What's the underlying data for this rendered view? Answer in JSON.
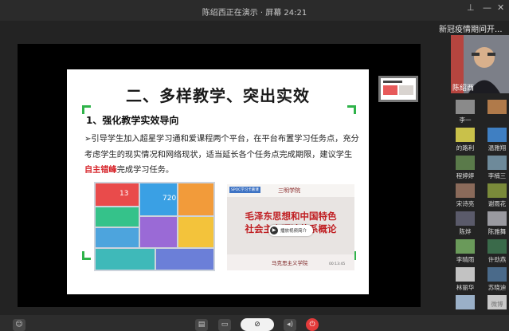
{
  "window": {
    "title": "陈绍西正在演示 · 屏幕 24:21",
    "pin_icon": "⊥",
    "minimize_icon": "—",
    "close_icon": "✕"
  },
  "slide": {
    "title": "二、多样教学、突出实效",
    "subhead": "1、强化教学实效导向",
    "para_before": "➢引导学生加入超星学习通和爱课程两个平台，在平台布置学习任务点，充分考虑学生的现实情况和网络现状，适当延长各个任务点完成期限，建议学生",
    "para_highlight": "自主错峰",
    "para_after": "完成学习任务。",
    "app_tiles": [
      {
        "label": "13",
        "color": "#e94b4b"
      },
      {
        "label": "720",
        "color": "#3aa0e4"
      },
      {
        "label": "",
        "color": "#f29b3a"
      },
      {
        "label": "",
        "color": "#35c28a"
      },
      {
        "label": "",
        "color": "#4da4dd"
      },
      {
        "label": "",
        "color": "#9a6ad6"
      },
      {
        "label": "",
        "color": "#f3c33b"
      },
      {
        "label": "",
        "color": "#3fb9b9"
      },
      {
        "label": "",
        "color": "#6b7fd8"
      }
    ],
    "video_badge": "SPOC学习卡慕课",
    "video_school": "三明学院",
    "video_title_1": "毛泽东思想和中国特色",
    "video_title_2": "社会主义理论体系概论",
    "video_play_label": "播放视频简介",
    "video_bottom": "马克思主义学院",
    "video_time": "00:13:45"
  },
  "controls": {
    "participants_icon": "people-icon",
    "chat_icon": "chat-icon",
    "folder_icon": "folder-icon",
    "camera_icon": "camera-off-icon",
    "volume_icon": "speaker-icon",
    "leave_icon": "power-icon"
  },
  "sidebar": {
    "meeting_title": "新冠疫情期间开...",
    "host_name": "陈绍西",
    "participants": [
      {
        "name": "李一",
        "color": "#8a8a8a"
      },
      {
        "name": "",
        "color": "#b07a4a"
      },
      {
        "name": "的路利",
        "color": "#c9c14a"
      },
      {
        "name": "温雅翔",
        "color": "#3f7fc2"
      },
      {
        "name": "程婷婷",
        "color": "#5a7a4a"
      },
      {
        "name": "李楠三",
        "color": "#6e8a9a"
      },
      {
        "name": "宋诗亮",
        "color": "#8a6a5a"
      },
      {
        "name": "谢雨花",
        "color": "#7a8a3a"
      },
      {
        "name": "陈烨",
        "color": "#5a5a6a"
      },
      {
        "name": "陈雅舞",
        "color": "#9a9aa0"
      },
      {
        "name": "李晴雨",
        "color": "#6a9a5a"
      },
      {
        "name": "许劲燕",
        "color": "#3a6a4a"
      },
      {
        "name": "林丽华",
        "color": "#c2c2c2"
      },
      {
        "name": "苏晓迪",
        "color": "#4a6a8a"
      },
      {
        "name": "",
        "color": "#9ab0c8"
      },
      {
        "name": "微博",
        "color": "#c8c8c8"
      }
    ]
  }
}
